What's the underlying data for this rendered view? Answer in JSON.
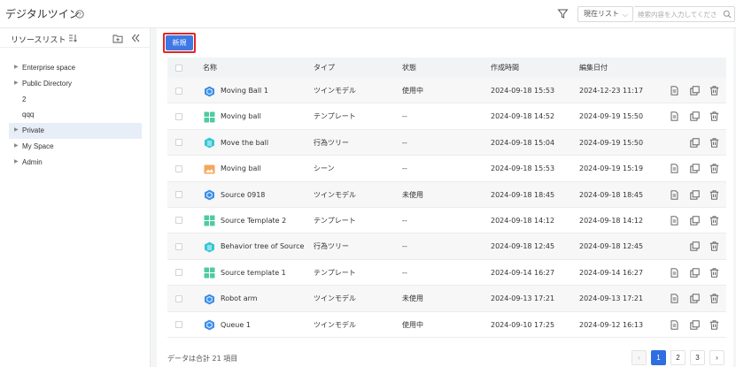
{
  "header": {
    "title": "デジタルツイン",
    "list_filter": "現在リスト",
    "search_placeholder": "検索内容を入力してください"
  },
  "sidebar": {
    "title": "リソースリスト",
    "items": [
      {
        "label": "Enterprise space",
        "has_children": true
      },
      {
        "label": "Public Directory",
        "has_children": true
      },
      {
        "label": "2",
        "has_children": false
      },
      {
        "label": "qqq",
        "has_children": false
      },
      {
        "label": "Private",
        "has_children": true,
        "selected": true
      },
      {
        "label": "My Space",
        "has_children": true
      },
      {
        "label": "Admin",
        "has_children": true
      }
    ]
  },
  "toolbar": {
    "new_label": "新規"
  },
  "table": {
    "headers": [
      "名称",
      "タイプ",
      "状態",
      "作成時間",
      "編集日付"
    ],
    "rows": [
      {
        "name": "Moving Ball 1",
        "icon": "twin-model-icon",
        "type": "ツインモデル",
        "status": "使用中",
        "created": "2024-09-18 15:53",
        "edited": "2024-12-23 11:17",
        "actions": [
          "document-icon",
          "copy-icon",
          "trash-icon"
        ]
      },
      {
        "name": "Moving ball",
        "icon": "template-icon",
        "type": "テンプレート",
        "status": "--",
        "created": "2024-09-18 14:52",
        "edited": "2024-09-19 15:50",
        "actions": [
          "document-icon",
          "copy-icon",
          "trash-icon"
        ]
      },
      {
        "name": "Move the ball",
        "icon": "behavior-tree-icon",
        "type": "行為ツリー",
        "status": "--",
        "created": "2024-09-18 15:04",
        "edited": "2024-09-19 15:50",
        "actions": [
          "copy-icon",
          "trash-icon"
        ]
      },
      {
        "name": "Moving ball",
        "icon": "scene-icon",
        "type": "シーン",
        "status": "--",
        "created": "2024-09-18 15:53",
        "edited": "2024-09-19 15:19",
        "actions": [
          "document-icon",
          "copy-icon",
          "trash-icon"
        ]
      },
      {
        "name": "Source 0918",
        "icon": "twin-model-icon",
        "type": "ツインモデル",
        "status": "未使用",
        "created": "2024-09-18 18:45",
        "edited": "2024-09-18 18:45",
        "actions": [
          "document-icon",
          "copy-icon",
          "trash-icon"
        ]
      },
      {
        "name": "Source Template 2",
        "icon": "template-icon",
        "type": "テンプレート",
        "status": "--",
        "created": "2024-09-18 14:12",
        "edited": "2024-09-18 14:12",
        "actions": [
          "document-icon",
          "copy-icon",
          "trash-icon"
        ]
      },
      {
        "name": "Behavior tree of Source",
        "icon": "behavior-tree-icon",
        "type": "行為ツリー",
        "status": "--",
        "created": "2024-09-18 12:45",
        "edited": "2024-09-18 12:45",
        "actions": [
          "copy-icon",
          "trash-icon"
        ]
      },
      {
        "name": "Source template 1",
        "icon": "template-icon",
        "type": "テンプレート",
        "status": "--",
        "created": "2024-09-14 16:27",
        "edited": "2024-09-14 16:27",
        "actions": [
          "document-icon",
          "copy-icon",
          "trash-icon"
        ]
      },
      {
        "name": "Robot arm",
        "icon": "twin-model-icon",
        "type": "ツインモデル",
        "status": "未使用",
        "created": "2024-09-13 17:21",
        "edited": "2024-09-13 17:21",
        "actions": [
          "document-icon",
          "copy-icon",
          "trash-icon"
        ]
      },
      {
        "name": "Queue 1",
        "icon": "twin-model-icon",
        "type": "ツインモデル",
        "status": "使用中",
        "created": "2024-09-10 17:25",
        "edited": "2024-09-12 16:13",
        "actions": [
          "document-icon",
          "copy-icon",
          "trash-icon"
        ]
      }
    ]
  },
  "footer": {
    "total_text": "データは合計 21 項目",
    "pages": [
      "1",
      "2",
      "3"
    ],
    "current_page": "1",
    "prev_symbol": "‹",
    "next_symbol": "›"
  },
  "colors": {
    "accent": "#3d78e6",
    "highlight_border": "#e8251f",
    "twin_model": "#3b8ee8",
    "template": "#4ecba0",
    "behavior_tree": "#35c6d6",
    "scene": "#f5a65b"
  }
}
